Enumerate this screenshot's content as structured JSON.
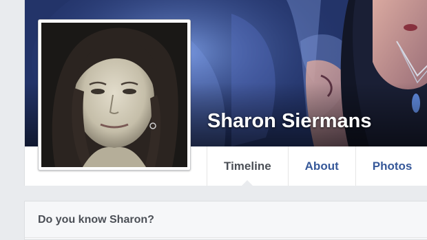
{
  "profile": {
    "name": "Sharon Siermans"
  },
  "nav": {
    "tabs": [
      {
        "label": "Timeline",
        "active": true
      },
      {
        "label": "About",
        "active": false
      },
      {
        "label": "Photos",
        "active": false
      }
    ]
  },
  "know_card": {
    "title": "Do you know Sharon?"
  },
  "colors": {
    "link_blue": "#365899",
    "active_gray": "#4b4f56",
    "page_bg": "#e9ebee"
  }
}
